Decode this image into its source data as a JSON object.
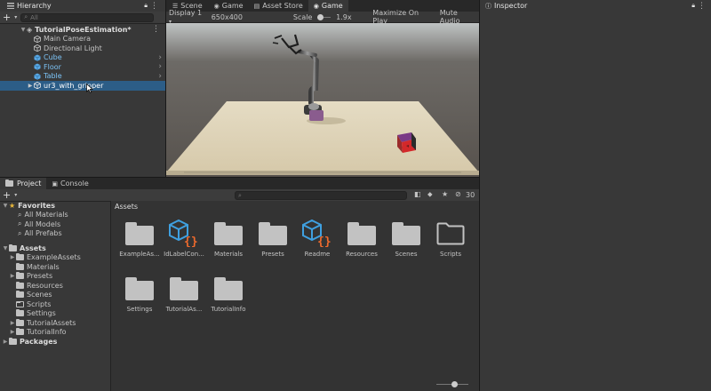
{
  "hierarchy": {
    "tab_label": "Hierarchy",
    "search_placeholder": "All",
    "scene_name": "TutorialPoseEstimation*",
    "items": [
      {
        "label": "Main Camera"
      },
      {
        "label": "Directional Light"
      },
      {
        "label": "Cube"
      },
      {
        "label": "Floor"
      },
      {
        "label": "Table"
      },
      {
        "label": "ur3_with_gripper"
      }
    ]
  },
  "center_tabs": [
    {
      "label": "Scene"
    },
    {
      "label": "Game"
    },
    {
      "label": "Asset Store"
    },
    {
      "label": "Game"
    }
  ],
  "game_toolbar": {
    "display": "Display 1",
    "resolution": "650x400",
    "scale_label": "Scale",
    "scale_value": "1.9x",
    "maximize": "Maximize On Play",
    "mute": "Mute Audio"
  },
  "inspector": {
    "tab_label": "Inspector"
  },
  "bottom_tabs": [
    {
      "label": "Project"
    },
    {
      "label": "Console"
    }
  ],
  "project": {
    "layer_count": "30",
    "favorites": {
      "label": "Favorites",
      "items": [
        {
          "label": "All Materials"
        },
        {
          "label": "All Models"
        },
        {
          "label": "All Prefabs"
        }
      ]
    },
    "assets": {
      "label": "Assets",
      "items": [
        {
          "label": "ExampleAssets"
        },
        {
          "label": "Materials"
        },
        {
          "label": "Presets"
        },
        {
          "label": "Resources"
        },
        {
          "label": "Scenes"
        },
        {
          "label": "Scripts"
        },
        {
          "label": "Settings"
        },
        {
          "label": "TutorialAssets"
        },
        {
          "label": "TutorialInfo"
        }
      ]
    },
    "packages_label": "Packages",
    "breadcrumb": "Assets",
    "grid": [
      {
        "label": "ExampleAs...",
        "kind": "folder"
      },
      {
        "label": "IdLabelCon...",
        "kind": "script"
      },
      {
        "label": "Materials",
        "kind": "folder"
      },
      {
        "label": "Presets",
        "kind": "folder"
      },
      {
        "label": "Readme",
        "kind": "script"
      },
      {
        "label": "Resources",
        "kind": "folder"
      },
      {
        "label": "Scenes",
        "kind": "folder"
      },
      {
        "label": "Scripts",
        "kind": "folder-empty"
      },
      {
        "label": "Settings",
        "kind": "folder"
      },
      {
        "label": "TutorialAs...",
        "kind": "folder"
      },
      {
        "label": "TutorialInfo",
        "kind": "folder"
      }
    ]
  },
  "colors": {
    "selection": "#2c5d87",
    "prefab_blue": "#7cc3f5",
    "script_icon_blue": "#3fa0e0",
    "script_icon_orange": "#ee6a2d"
  }
}
